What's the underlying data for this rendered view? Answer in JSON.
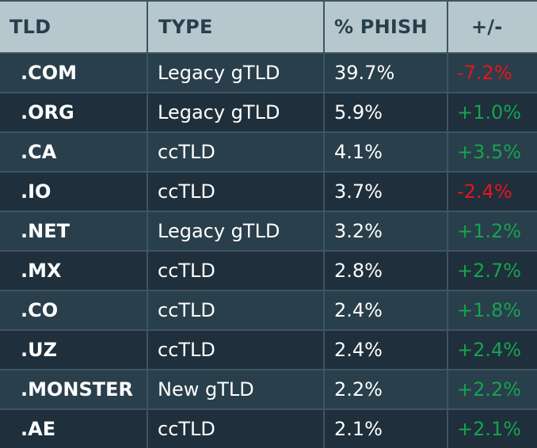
{
  "table": {
    "headers": [
      "TLD",
      "TYPE",
      "% PHISH",
      "+/-"
    ],
    "rows": [
      {
        "tld": ".COM",
        "type": "Legacy gTLD",
        "phish": "39.7%",
        "change": "-7.2%",
        "trend": "negative"
      },
      {
        "tld": ".ORG",
        "type": "Legacy gTLD",
        "phish": "5.9%",
        "change": "+1.0%",
        "trend": "positive"
      },
      {
        "tld": ".CA",
        "type": "ccTLD",
        "phish": "4.1%",
        "change": "+3.5%",
        "trend": "positive"
      },
      {
        "tld": ".IO",
        "type": "ccTLD",
        "phish": "3.7%",
        "change": "-2.4%",
        "trend": "negative"
      },
      {
        "tld": ".NET",
        "type": "Legacy gTLD",
        "phish": "3.2%",
        "change": "+1.2%",
        "trend": "positive"
      },
      {
        "tld": ".MX",
        "type": "ccTLD",
        "phish": "2.8%",
        "change": "+2.7%",
        "trend": "positive"
      },
      {
        "tld": ".CO",
        "type": "ccTLD",
        "phish": "2.4%",
        "change": "+1.8%",
        "trend": "positive"
      },
      {
        "tld": ".UZ",
        "type": "ccTLD",
        "phish": "2.4%",
        "change": "+2.4%",
        "trend": "positive"
      },
      {
        "tld": ".MONSTER",
        "type": "New gTLD",
        "phish": "2.2%",
        "change": "+2.2%",
        "trend": "positive"
      },
      {
        "tld": ".AE",
        "type": "ccTLD",
        "phish": "2.1%",
        "change": "+2.1%",
        "trend": "positive"
      }
    ]
  },
  "colors": {
    "header_bg": "#b7c7ce",
    "header_text": "#263f4c",
    "row_odd_bg": "#293f4b",
    "row_even_bg": "#1f2f3b",
    "grid_line": "#3d5563",
    "text": "#ffffff",
    "negative": "#e8141c",
    "positive": "#16a34f"
  }
}
